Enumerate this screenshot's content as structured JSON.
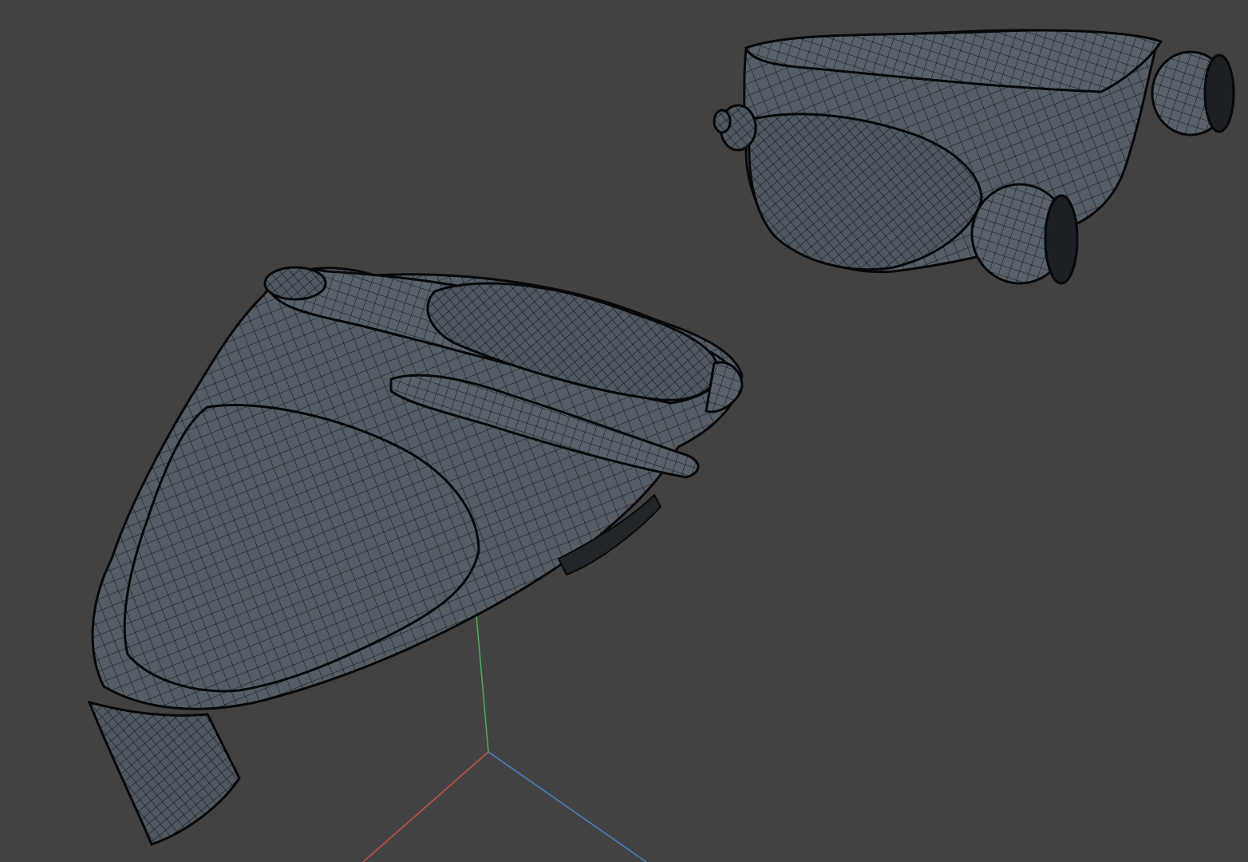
{
  "viewport": {
    "background_color": "#424242",
    "mesh_fill_color": "#555e66",
    "mesh_wire_color": "#101214",
    "mesh_edge_color": "#06080a",
    "axis_colors": {
      "x": "#c8504b",
      "y": "#4bb15b",
      "z": "#4b7fc8"
    }
  },
  "objects": [
    {
      "name": "front-housing-mesh",
      "kind": "wireframe-mesh"
    },
    {
      "name": "rear-housing-mesh",
      "kind": "wireframe-mesh"
    }
  ],
  "gizmo": {
    "name": "world-axis-gizmo"
  }
}
